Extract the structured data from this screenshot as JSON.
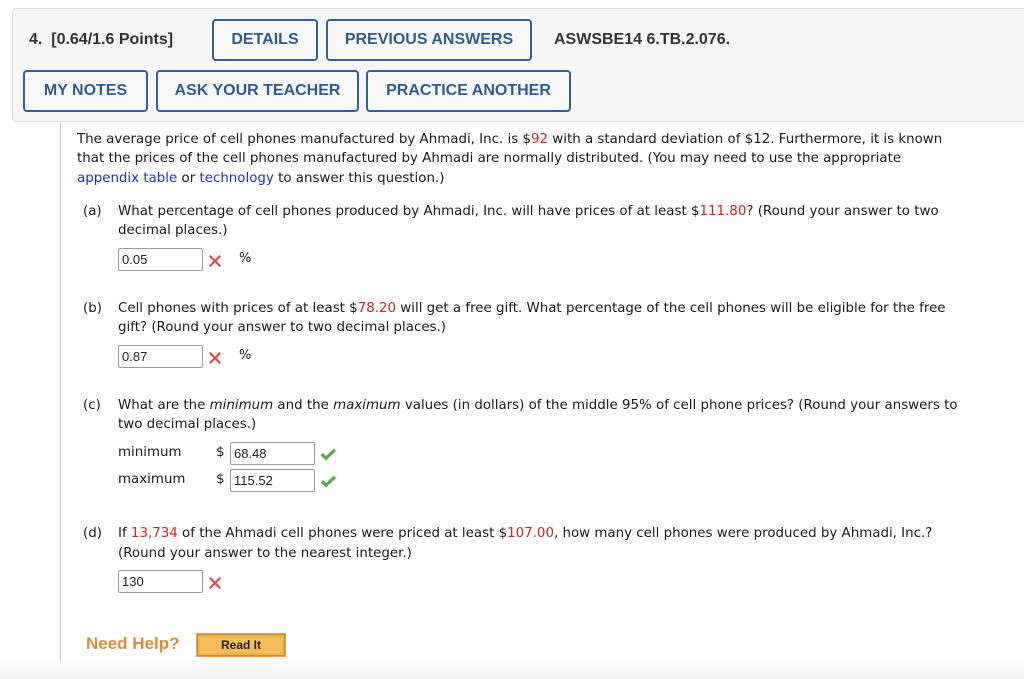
{
  "header": {
    "question_number": "4.",
    "points": "[0.64/1.6 Points]",
    "details_label": "DETAILS",
    "previous_answers_label": "PREVIOUS ANSWERS",
    "question_id": "ASWSBE14 6.TB.2.076.",
    "my_notes_label": "MY NOTES",
    "ask_teacher_label": "ASK YOUR TEACHER",
    "practice_another_label": "PRACTICE ANOTHER"
  },
  "intro": {
    "line1_a": "The average price of cell phones manufactured by Ahmadi, Inc. is $",
    "mean": "92",
    "line1_b": " with a standard deviation of $12. Furthermore, it is known",
    "line2": "that the prices of the cell phones manufactured by Ahmadi are normally distributed. (You may need to use the appropriate",
    "link_appendix": "appendix table",
    "or": " or ",
    "link_technology": "technology",
    "line3_end": " to answer this question.)"
  },
  "parts": {
    "a": {
      "label": "(a)",
      "text1_a": "What percentage of cell phones produced by Ahmadi, Inc. will have prices of at least $",
      "value": "111.80",
      "text1_b": "? (Round your answer to two",
      "text2": "decimal places.)",
      "answer": "0.05",
      "status": "incorrect",
      "unit": "%"
    },
    "b": {
      "label": "(b)",
      "text1_a": "Cell phones with prices of at least $",
      "value": "78.20",
      "text1_b": " will get a free gift. What percentage of the cell phones will be eligible for the free",
      "text2": "gift? (Round your answer to two decimal places.)",
      "answer": "0.87",
      "status": "incorrect",
      "unit": "%"
    },
    "c": {
      "label": "(c)",
      "text1_a": "What are the ",
      "em1": "minimum",
      "text1_b": " and the ",
      "em2": "maximum",
      "text1_c": " values (in dollars) of the middle 95% of cell phone prices? (Round your answers to",
      "text2": "two decimal places.)",
      "min_label": "minimum",
      "max_label": "maximum",
      "currency": "$",
      "min_answer": "68.48",
      "max_answer": "115.52",
      "min_status": "correct",
      "max_status": "correct"
    },
    "d": {
      "label": "(d)",
      "text1_a": "If ",
      "count": "13,734",
      "text1_b": " of the Ahmadi cell phones were priced at least $",
      "value": "107.00",
      "text1_c": ", how many cell phones were produced by Ahmadi, Inc.?",
      "text2": "(Round your answer to the nearest integer.)",
      "answer": "130",
      "status": "incorrect"
    }
  },
  "help": {
    "need_help": "Need Help?",
    "read_it_label": "Read It"
  },
  "colors": {
    "button_border": "#2f6196",
    "highlight_red": "#d0261b",
    "link_blue": "#1a35b8",
    "incorrect_red": "#e0454a",
    "correct_green": "#5aaa4c",
    "help_orange": "#e08a34"
  }
}
